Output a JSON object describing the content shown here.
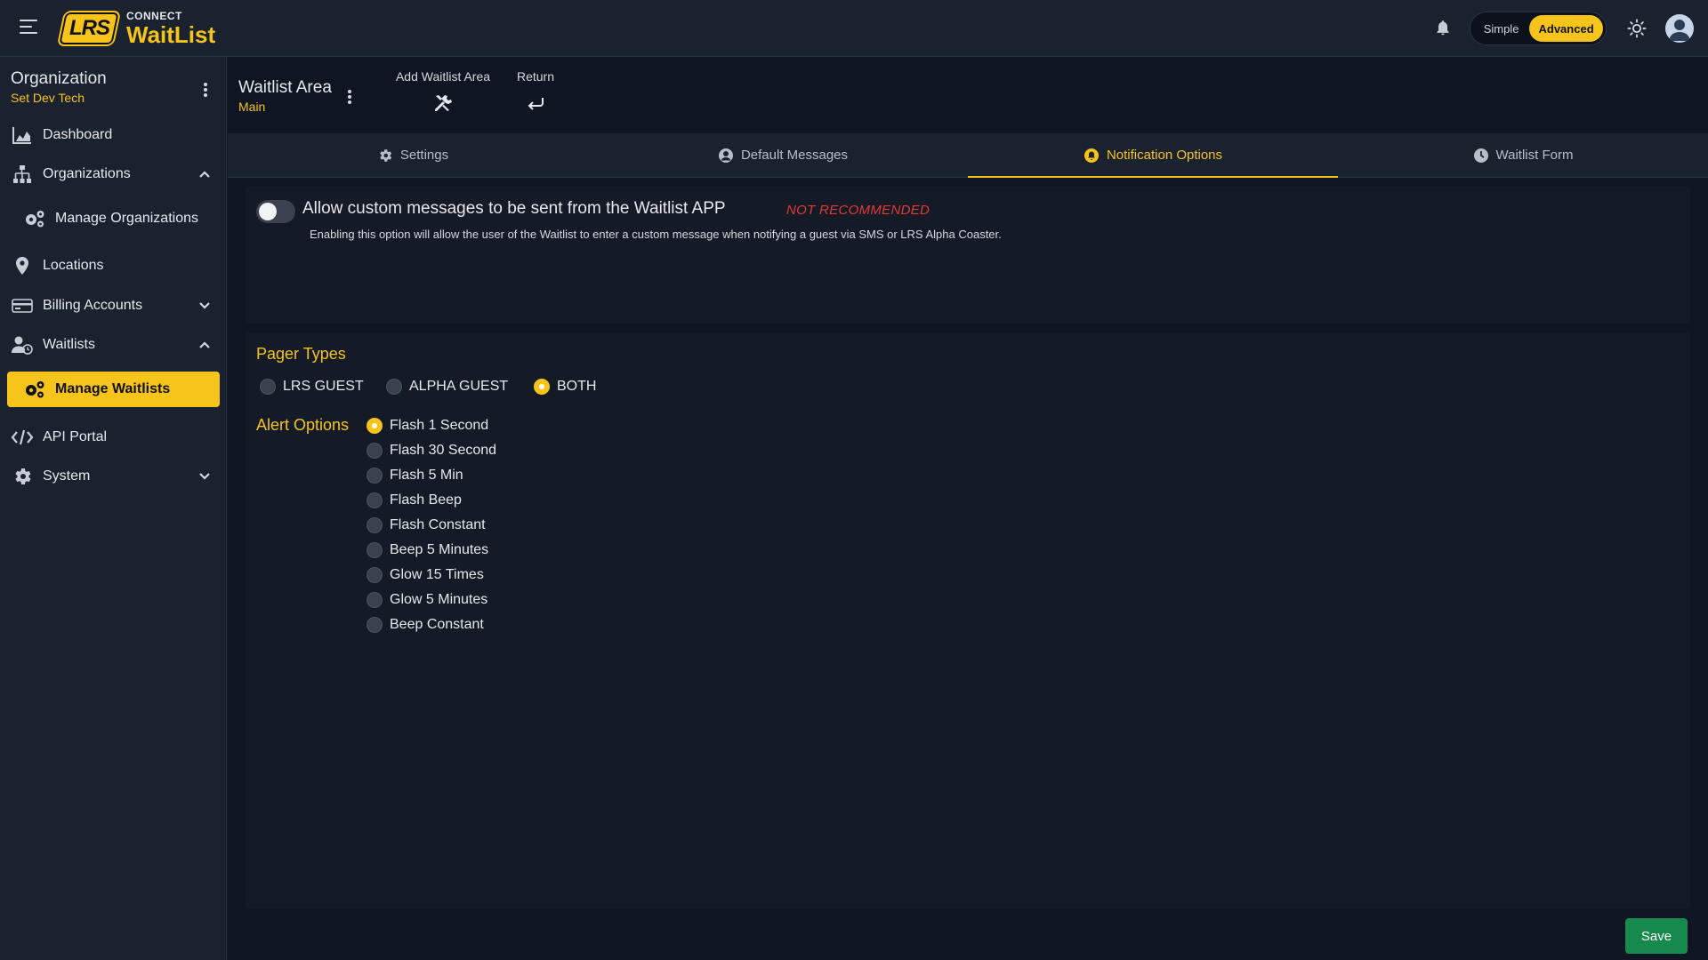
{
  "header": {
    "logo_mark": "LRS",
    "logo_connect": "CONNECT",
    "logo_product": "WaitList",
    "mode_simple": "Simple",
    "mode_advanced": "Advanced",
    "mode_selected": "Advanced"
  },
  "sidebar": {
    "org_title": "Organization",
    "org_sub": "Set Dev Tech",
    "items": [
      {
        "label": "Dashboard",
        "icon": "chart-icon"
      },
      {
        "label": "Organizations",
        "icon": "org-tree-icon",
        "expanded": true
      },
      {
        "label": "Manage Organizations",
        "icon": "gears-icon"
      },
      {
        "label": "Locations",
        "icon": "location-pin-icon"
      },
      {
        "label": "Billing Accounts",
        "icon": "credit-card-icon",
        "expanded": false
      },
      {
        "label": "Waitlists",
        "icon": "users-clock-icon",
        "expanded": true
      },
      {
        "label": "Manage Waitlists",
        "icon": "gears-icon",
        "active": true
      },
      {
        "label": "API Portal",
        "icon": "code-icon"
      },
      {
        "label": "System",
        "icon": "gear-icon",
        "expanded": false
      }
    ]
  },
  "content_header": {
    "title": "Waitlist Area",
    "subtitle": "Main",
    "add_label": "Add Waitlist Area",
    "return_label": "Return"
  },
  "tabs": [
    {
      "label": "Settings",
      "icon": "gear-icon"
    },
    {
      "label": "Default Messages",
      "icon": "user-circle-icon"
    },
    {
      "label": "Notification Options",
      "icon": "bell-circle-icon",
      "active": true
    },
    {
      "label": "Waitlist Form",
      "icon": "clock-icon"
    }
  ],
  "custom_messages": {
    "enabled": false,
    "label": "Allow custom messages to be sent from the Waitlist APP",
    "warning": "NOT RECOMMENDED",
    "description": "Enabling this option will allow the user of the Waitlist to enter a custom message when notifying a guest via SMS or LRS Alpha Coaster."
  },
  "pager_types": {
    "title": "Pager Types",
    "options": [
      "LRS GUEST",
      "ALPHA GUEST",
      "BOTH"
    ],
    "selected": "BOTH"
  },
  "alert_options": {
    "title": "Alert Options",
    "options": [
      "Flash 1 Second",
      "Flash 30 Second",
      "Flash 5 Min",
      "Flash Beep",
      "Flash Constant",
      "Beep 5 Minutes",
      "Glow 15 Times",
      "Glow 5 Minutes",
      "Beep Constant"
    ],
    "selected": "Flash 1 Second"
  },
  "footer": {
    "save_label": "Save"
  },
  "colors": {
    "accent": "#f7c41c",
    "background": "#0f1522",
    "surface": "#1a2230",
    "warning": "#e53935",
    "save": "#168a4d"
  }
}
